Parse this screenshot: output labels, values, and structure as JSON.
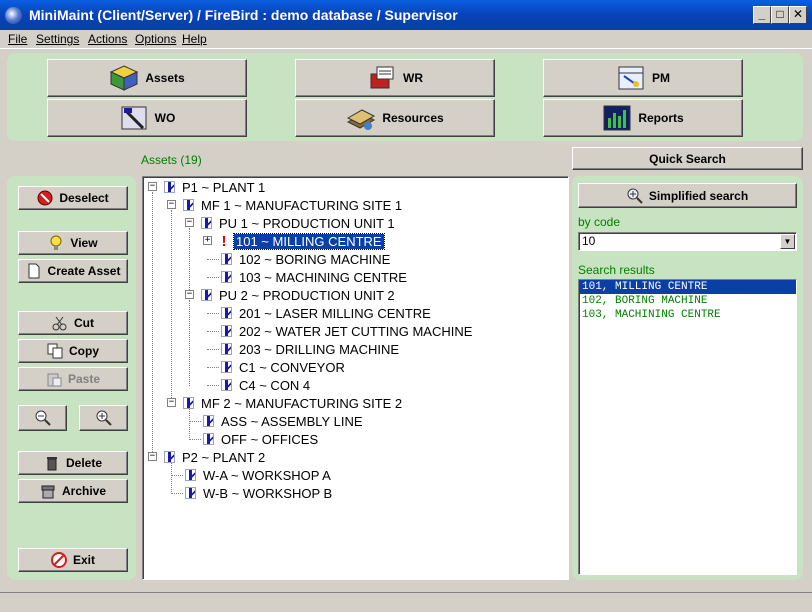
{
  "window": {
    "title": "MiniMaint (Client/Server) / FireBird : demo database /   Supervisor",
    "minimize": "_",
    "maximize": "□",
    "close": "✕"
  },
  "menu": [
    "File",
    "Settings",
    "Actions",
    "Options",
    "Help"
  ],
  "modules": {
    "assets": "Assets",
    "wr": "WR",
    "pm": "PM",
    "wo": "WO",
    "resources": "Resources",
    "reports": "Reports"
  },
  "tree": {
    "caption": "Assets (19)",
    "nodes": [
      {
        "label": "P1 ~ PLANT 1"
      },
      {
        "label": "MF 1 ~ MANUFACTURING SITE 1"
      },
      {
        "label": "PU 1 ~ PRODUCTION UNIT 1"
      },
      {
        "label": "101 ~ MILLING CENTRE"
      },
      {
        "label": "102 ~ BORING MACHINE"
      },
      {
        "label": "103 ~ MACHINING CENTRE"
      },
      {
        "label": "PU 2 ~ PRODUCTION UNIT 2"
      },
      {
        "label": "201 ~ LASER MILLING CENTRE"
      },
      {
        "label": "202 ~ WATER JET CUTTING MACHINE"
      },
      {
        "label": "203 ~ DRILLING MACHINE"
      },
      {
        "label": "C1 ~ CONVEYOR"
      },
      {
        "label": "C4 ~ CON 4"
      },
      {
        "label": "MF 2 ~ MANUFACTURING SITE 2"
      },
      {
        "label": "ASS ~ ASSEMBLY LINE"
      },
      {
        "label": "OFF ~ OFFICES"
      },
      {
        "label": "P2 ~ PLANT 2"
      },
      {
        "label": "W-A ~ WORKSHOP  A"
      },
      {
        "label": "W-B ~ WORKSHOP  B"
      }
    ]
  },
  "actions": {
    "deselect": "Deselect",
    "view": "View",
    "create_asset": "Create Asset",
    "cut": "Cut",
    "copy": "Copy",
    "paste": "Paste",
    "delete": "Delete",
    "archive": "Archive",
    "exit": "Exit"
  },
  "search": {
    "quick_search": "Quick Search",
    "simplified": "Simplified search",
    "by_code_label": "by code",
    "by_code_value": "10",
    "results_label": "Search results",
    "results": [
      "101, MILLING CENTRE",
      "102, BORING MACHINE",
      "103, MACHINING CENTRE"
    ]
  },
  "colors": {
    "panel": "#c7e3c1",
    "titlebar": "#0842b8",
    "selection": "#0a3fa8",
    "results_text": "#008000"
  }
}
